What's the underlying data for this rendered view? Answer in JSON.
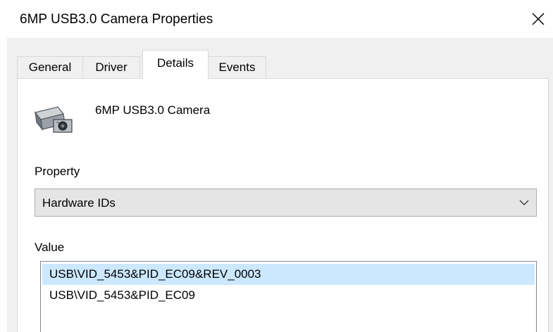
{
  "window": {
    "title": "6MP USB3.0 Camera Properties"
  },
  "tabs": [
    {
      "label": "General"
    },
    {
      "label": "Driver"
    },
    {
      "label": "Details",
      "active": true
    },
    {
      "label": "Events"
    }
  ],
  "device": {
    "name": "6MP USB3.0 Camera",
    "icon": "camera-icon"
  },
  "property": {
    "label": "Property",
    "selected": "Hardware IDs"
  },
  "value": {
    "label": "Value",
    "items": [
      {
        "text": "USB\\VID_5453&PID_EC09&REV_0003",
        "selected": true
      },
      {
        "text": "USB\\VID_5453&PID_EC09",
        "selected": false
      }
    ]
  },
  "colors": {
    "client_background": "#f0f0f0",
    "selection": "#cce8ff",
    "combo_background": "#e5e5e5"
  }
}
